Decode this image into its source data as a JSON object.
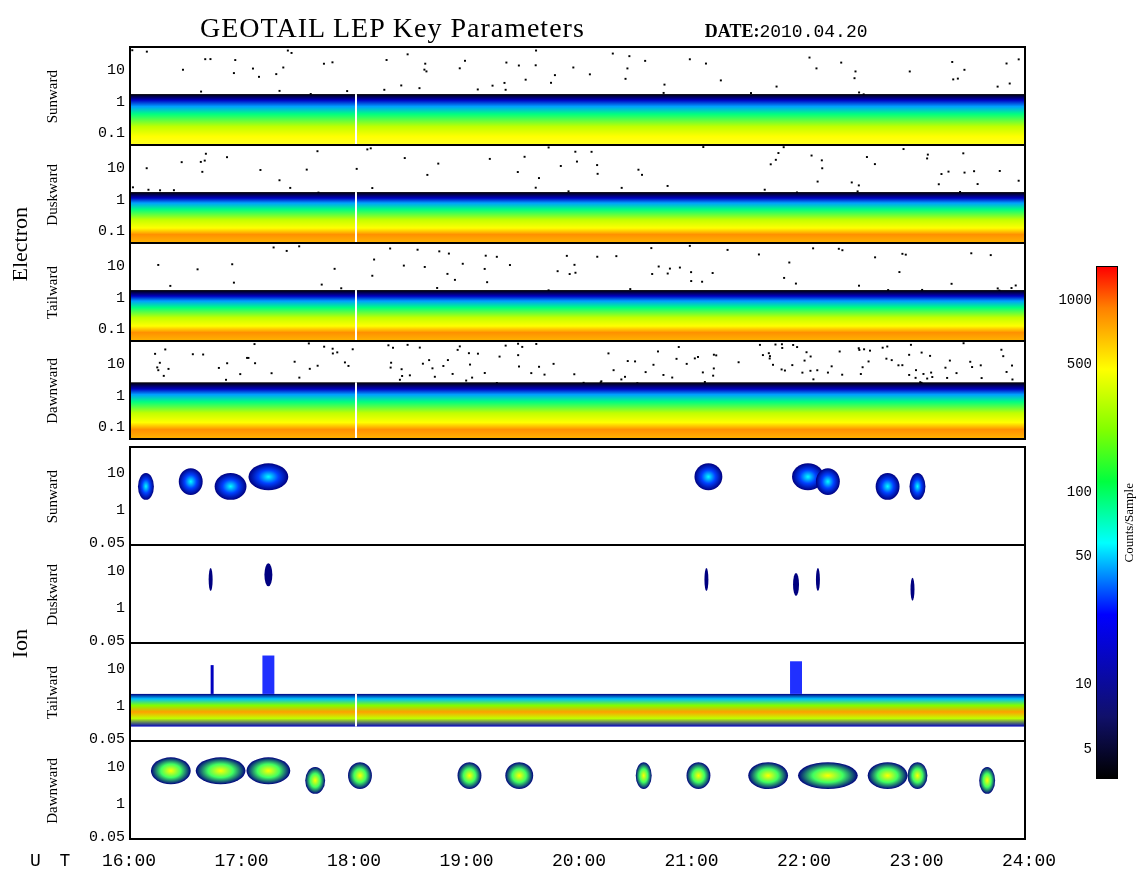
{
  "title": "GEOTAIL LEP Key Parameters",
  "date": {
    "label": "DATE:",
    "value": "2010.04.20"
  },
  "groups": [
    {
      "name": "Electron",
      "kind": "electron",
      "panels": [
        {
          "label": "Sunward",
          "kind": "band",
          "yticks": [
            "10",
            "1",
            "0.1"
          ]
        },
        {
          "label": "Duskward",
          "kind": "band-hot",
          "yticks": [
            "10",
            "1",
            "0.1"
          ]
        },
        {
          "label": "Tailward",
          "kind": "band-hot",
          "yticks": [
            "10",
            "1",
            "0.1"
          ]
        },
        {
          "label": "Dawnward",
          "kind": "band-wide",
          "yticks": [
            "10",
            "1",
            "0.1"
          ]
        }
      ]
    },
    {
      "name": "Ion",
      "kind": "ion",
      "panels": [
        {
          "label": "Sunward",
          "kind": "patches",
          "yticks": [
            "10",
            "1",
            "0.05"
          ]
        },
        {
          "label": "Duskward",
          "kind": "sparse",
          "yticks": [
            "10",
            "1",
            "0.05"
          ]
        },
        {
          "label": "Tailward",
          "kind": "low-band",
          "yticks": [
            "10",
            "1",
            "0.05"
          ]
        },
        {
          "label": "Dawnward",
          "kind": "patches-full",
          "yticks": [
            "10",
            "1",
            "0.05"
          ]
        }
      ]
    }
  ],
  "xaxis": {
    "label": "U T",
    "ticks": [
      "16:00",
      "17:00",
      "18:00",
      "19:00",
      "20:00",
      "21:00",
      "22:00",
      "23:00",
      "24:00"
    ]
  },
  "colorbar": {
    "title": "Counts/Sample",
    "ticks": [
      "1000",
      "500",
      "100",
      "50",
      "10",
      "5"
    ]
  }
}
